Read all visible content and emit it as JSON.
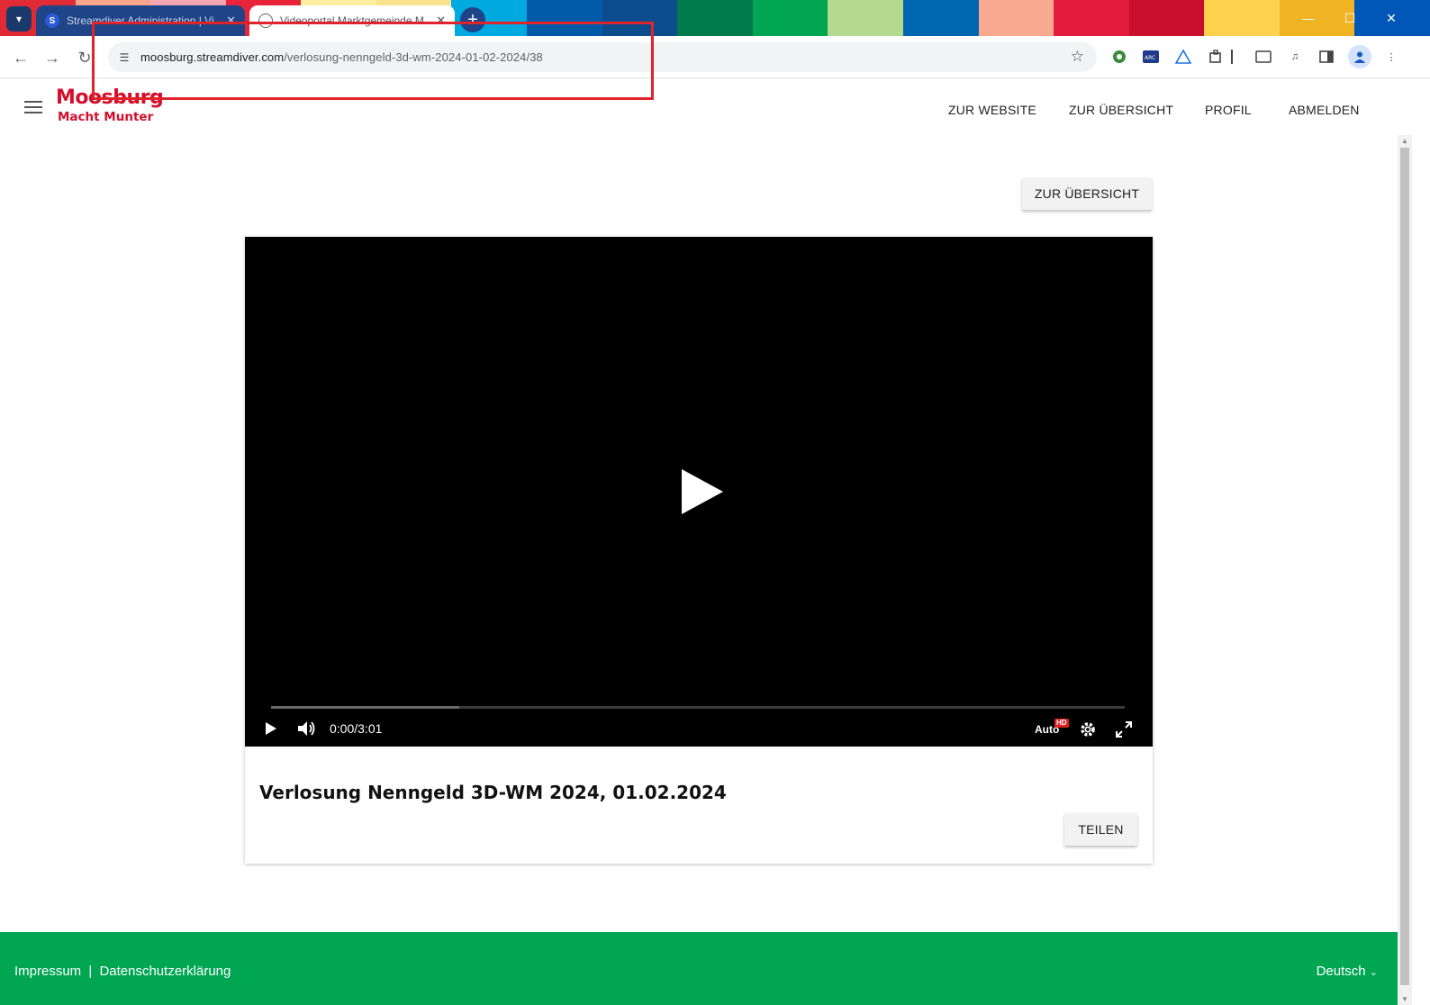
{
  "browser": {
    "tabs": [
      {
        "title": "Streamdiver Administration | Vi",
        "active": false
      },
      {
        "title": "Videoportal Marktgemeinde M",
        "active": true
      }
    ],
    "url_host": "moosburg.streamdiver.com",
    "url_path": "/verlosung-nenngeld-3d-wm-2024-01-02-2024/38",
    "colors": {
      "tabstrip_stripes": [
        "#e02b35",
        "#f7a58a",
        "#f4a7b0",
        "#e8233a",
        "#fef0a0",
        "#fbe18c",
        "#00a9e0",
        "#005aa7",
        "#0a4c8c",
        "#007b4a",
        "#00a651",
        "#b5d98f",
        "#0067b1",
        "#f8a98f",
        "#e31b3c",
        "#c8102e",
        "#fdd14c",
        "#f0b323",
        "#0057b8"
      ]
    }
  },
  "site": {
    "logo_line1": "Moosburg",
    "logo_line2": "Macht Munter",
    "nav": [
      "ZUR WEBSITE",
      "ZUR ÜBERSICHT",
      "PROFIL",
      "ABMELDEN"
    ],
    "back_button": "ZUR ÜBERSICHT",
    "brand_red": "#d40f2c",
    "footer_green": "#00a651"
  },
  "player": {
    "time": "0:00/3:01",
    "quality": "Auto",
    "hd_badge": "HD",
    "buffered_fraction": 0.22
  },
  "video": {
    "title": "Verlosung Nenngeld 3D-WM 2024, 01.02.2024",
    "share_button": "TEILEN"
  },
  "footer": {
    "impressum": "Impressum",
    "separator": "|",
    "privacy": "Datenschutzerklärung",
    "language": "Deutsch"
  }
}
